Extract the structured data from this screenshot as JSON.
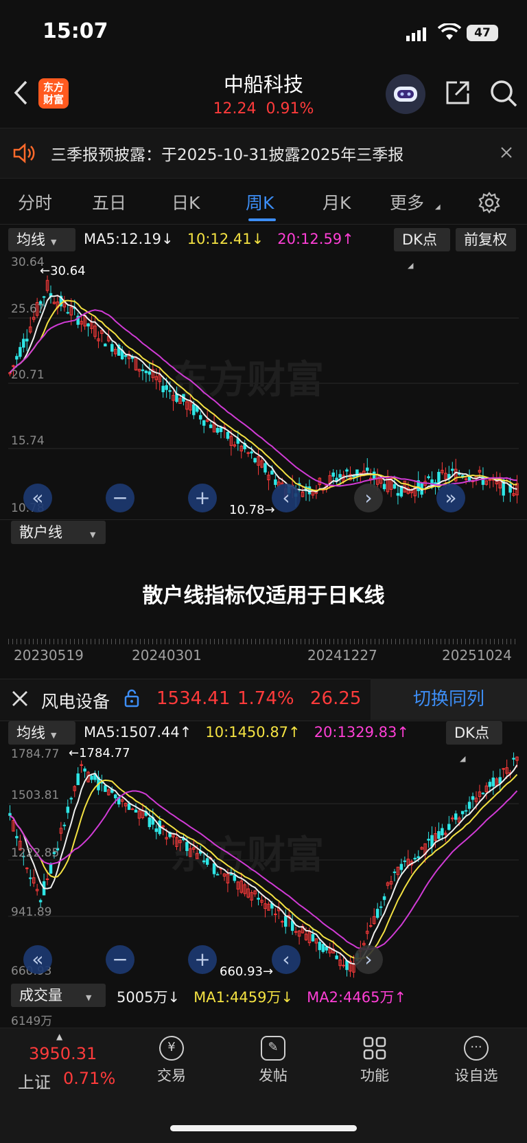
{
  "status": {
    "time": "15:07",
    "battery": "47"
  },
  "header": {
    "title": "中船科技",
    "price": "12.24",
    "change_pct": "0.91%",
    "logo_text_line1": "东方",
    "logo_text_line2": "财富"
  },
  "notice": {
    "text": "三季报预披露：于2025-10-31披露2025年三季报"
  },
  "tabs": [
    "分时",
    "五日",
    "日K",
    "周K",
    "月K",
    "更多"
  ],
  "main_chart": {
    "indicator_select": "均线",
    "ma5": "MA5:12.19",
    "ma10": "10:12.41",
    "ma20": "20:12.59",
    "ma5_arrow": "↓",
    "ma10_arrow": "↓",
    "ma20_arrow": "↑",
    "dk_label": "DK点",
    "adjust_label": "前复权",
    "y_labels": [
      "30.64",
      "25.67",
      "20.71",
      "15.74",
      "10.78"
    ],
    "high_label": "←30.64",
    "low_label": "10.78→",
    "watermark": "东方财富"
  },
  "sub_panel": {
    "select": "散户线",
    "message": "散户线指标仅适用于日K线",
    "dates": [
      "20230519",
      "20240301",
      "20241227",
      "20251024"
    ]
  },
  "compare": {
    "name": "风电设备",
    "value": "1534.41",
    "pct": "1.74%",
    "chg": "26.25",
    "switch_label": "切换同列"
  },
  "compare_chart": {
    "indicator_select": "均线",
    "ma5": "MA5:1507.44",
    "ma10": "10:1450.87",
    "ma20": "20:1329.83",
    "ma5_arrow": "↑",
    "ma10_arrow": "↑",
    "ma20_arrow": "↑",
    "dk_label": "DK点",
    "y_labels": [
      "1784.77",
      "1503.81",
      "1222.85",
      "941.89",
      "660.93"
    ],
    "high_label": "←1784.77",
    "low_label": "660.93→"
  },
  "volume": {
    "select": "成交量",
    "value": "5005万",
    "ma1": "MA1:4459万",
    "ma2": "MA2:4465万",
    "value_arrow": "↓",
    "ma1_arrow": "↓",
    "ma2_arrow": "↑",
    "top_label": "6149万"
  },
  "bottom_nav": {
    "index_value": "3950.31",
    "index_name": "上证",
    "index_pct": "0.71%",
    "items": [
      "交易",
      "发帖",
      "功能",
      "设自选"
    ]
  }
}
